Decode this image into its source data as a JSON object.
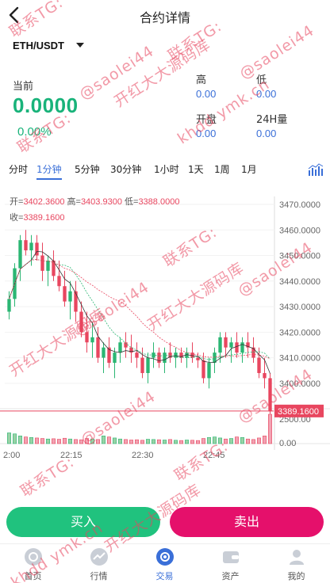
{
  "header": {
    "title": "合约详情",
    "back_icon": "chevron-left-icon"
  },
  "pair": {
    "symbol": "ETH/USDT"
  },
  "ticker": {
    "current_label": "当前",
    "price": "0.0000",
    "change": "0.00%",
    "high_label": "高",
    "high_value": "0.00",
    "low_label": "低",
    "low_value": "0.00",
    "open_label": "开盘",
    "open_value": "0.00",
    "vol_label": "24H量",
    "vol_value": "0.00"
  },
  "tabs": [
    {
      "label": "分时"
    },
    {
      "label": "1分钟"
    },
    {
      "label": "5分钟"
    },
    {
      "label": "30分钟"
    },
    {
      "label": "1小时"
    },
    {
      "label": "1天"
    },
    {
      "label": "1周"
    },
    {
      "label": "1月"
    }
  ],
  "active_tab": "1分钟",
  "ohlc": {
    "open_label": "开=",
    "open": "3402.3600",
    "high_label": "高=",
    "high": "3403.9300",
    "low_label": "低=",
    "low": "3388.0000",
    "close_label": "收=",
    "close": "3389.1600"
  },
  "chart_data": {
    "type": "candlestick",
    "y_ticks": [
      "3470.0000",
      "3460.0000",
      "3450.0000",
      "3440.0000",
      "3430.0000",
      "3420.0000",
      "3410.0000",
      "3400.0000"
    ],
    "ylim": [
      3395,
      3470
    ],
    "volume_ticks": [
      "2500.00",
      "0.00"
    ],
    "x_ticks": [
      "2:00",
      "22:15",
      "22:30",
      "22:45"
    ],
    "last_price_label": "3389.1600",
    "last_price": 3389.16,
    "colors": {
      "up": "#2bb673",
      "down": "#e8465f"
    },
    "candles": [
      [
        3428,
        3436,
        3425,
        3433
      ],
      [
        3433,
        3447,
        3430,
        3445
      ],
      [
        3445,
        3458,
        3440,
        3456
      ],
      [
        3456,
        3460,
        3450,
        3452
      ],
      [
        3452,
        3458,
        3446,
        3455
      ],
      [
        3455,
        3458,
        3448,
        3450
      ],
      [
        3450,
        3455,
        3440,
        3444
      ],
      [
        3444,
        3450,
        3438,
        3448
      ],
      [
        3448,
        3452,
        3440,
        3442
      ],
      [
        3442,
        3448,
        3436,
        3438
      ],
      [
        3438,
        3444,
        3430,
        3432
      ],
      [
        3432,
        3440,
        3425,
        3436
      ],
      [
        3436,
        3440,
        3424,
        3428
      ],
      [
        3428,
        3432,
        3418,
        3420
      ],
      [
        3420,
        3428,
        3412,
        3416
      ],
      [
        3416,
        3424,
        3410,
        3418
      ],
      [
        3418,
        3422,
        3408,
        3410
      ],
      [
        3410,
        3416,
        3404,
        3414
      ],
      [
        3414,
        3418,
        3406,
        3408
      ],
      [
        3408,
        3414,
        3402,
        3412
      ],
      [
        3412,
        3418,
        3408,
        3416
      ],
      [
        3416,
        3420,
        3410,
        3414
      ],
      [
        3414,
        3419,
        3408,
        3412
      ],
      [
        3412,
        3416,
        3406,
        3410
      ],
      [
        3410,
        3414,
        3402,
        3404
      ],
      [
        3404,
        3412,
        3400,
        3410
      ],
      [
        3410,
        3416,
        3406,
        3412
      ],
      [
        3412,
        3414,
        3406,
        3408
      ],
      [
        3408,
        3414,
        3404,
        3412
      ],
      [
        3412,
        3416,
        3408,
        3410
      ],
      [
        3410,
        3414,
        3406,
        3412
      ],
      [
        3412,
        3414,
        3408,
        3410
      ],
      [
        3410,
        3414,
        3406,
        3412
      ],
      [
        3412,
        3416,
        3408,
        3410
      ],
      [
        3410,
        3412,
        3406,
        3409
      ],
      [
        3409,
        3412,
        3400,
        3402
      ],
      [
        3402,
        3410,
        3398,
        3408
      ],
      [
        3408,
        3414,
        3404,
        3412
      ],
      [
        3412,
        3420,
        3408,
        3418
      ],
      [
        3418,
        3420,
        3410,
        3414
      ],
      [
        3414,
        3418,
        3408,
        3416
      ],
      [
        3416,
        3420,
        3410,
        3412
      ],
      [
        3412,
        3418,
        3408,
        3416
      ],
      [
        3416,
        3420,
        3410,
        3414
      ],
      [
        3414,
        3418,
        3408,
        3410
      ],
      [
        3410,
        3414,
        3402,
        3404
      ],
      [
        3404,
        3410,
        3398,
        3402
      ],
      [
        3402,
        3404,
        3388,
        3389
      ]
    ],
    "volumes": [
      420,
      380,
      300,
      260,
      240,
      220,
      200,
      180,
      190,
      170,
      210,
      180,
      160,
      150,
      200,
      180,
      160,
      300,
      260,
      220,
      180,
      160,
      140,
      150,
      130,
      170,
      160,
      150,
      140,
      160,
      130,
      120,
      140,
      130,
      120,
      200,
      240,
      260,
      220,
      180,
      200,
      260,
      240,
      180,
      160,
      220,
      300,
      1150
    ]
  },
  "buttons": {
    "buy": "买入",
    "sell": "卖出"
  },
  "nav": [
    {
      "label": "首页",
      "icon": "home-icon"
    },
    {
      "label": "行情",
      "icon": "market-icon"
    },
    {
      "label": "交易",
      "icon": "trade-icon"
    },
    {
      "label": "资产",
      "icon": "wallet-icon"
    },
    {
      "label": "我的",
      "icon": "user-icon"
    }
  ],
  "active_nav": "交易",
  "watermarks": [
    "联系TG:",
    "@saolei44",
    "开红大大源码库",
    "khdd ymk.cn"
  ]
}
